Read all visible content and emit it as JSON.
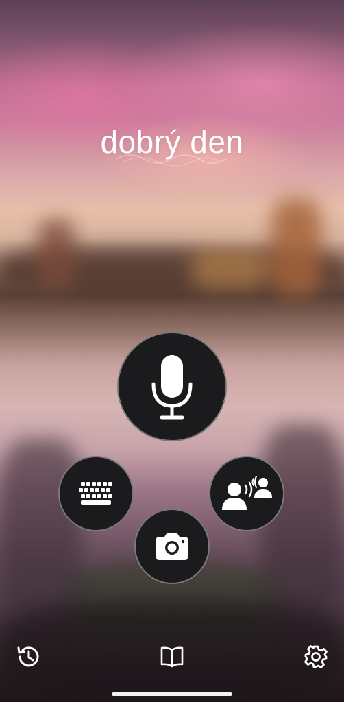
{
  "greeting": {
    "text": "dobrý den"
  },
  "actions": {
    "microphone": {
      "icon": "microphone-icon"
    },
    "keyboard": {
      "icon": "keyboard-icon"
    },
    "conversation": {
      "icon": "conversation-icon"
    },
    "camera": {
      "icon": "camera-icon"
    }
  },
  "bottom_bar": {
    "history": {
      "icon": "history-icon"
    },
    "phrasebook": {
      "icon": "book-icon"
    },
    "settings": {
      "icon": "gear-icon"
    }
  },
  "colors": {
    "button_background": "#1b1b1d",
    "icon": "#ffffff",
    "button_border": "#c8c8c8"
  }
}
